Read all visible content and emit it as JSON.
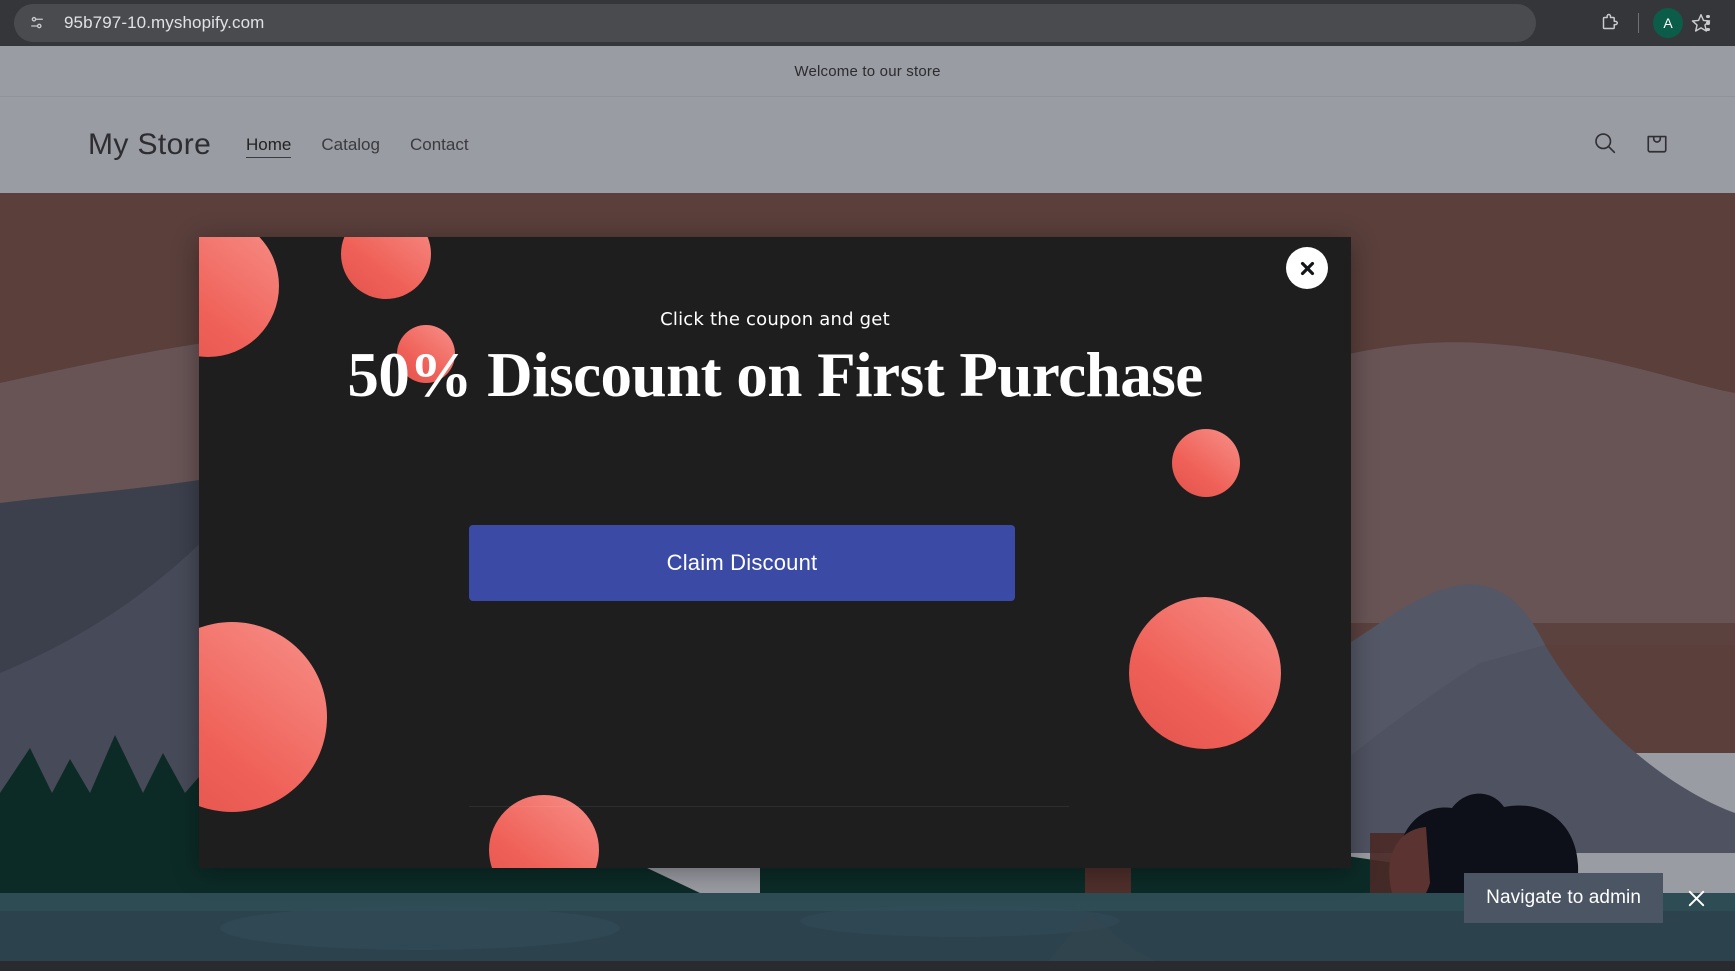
{
  "browser": {
    "url": "95b797-10.myshopify.com",
    "site_info_icon": "tune-icon",
    "bookmark_icon": "star-icon",
    "extensions_icon": "puzzle-piece-icon",
    "profile_initial": "A",
    "menu_icon": "three-dot-menu-icon"
  },
  "store": {
    "announcement": "Welcome to our store",
    "logo": "My Store",
    "nav": [
      {
        "label": "Home",
        "active": true
      },
      {
        "label": "Catalog",
        "active": false
      },
      {
        "label": "Contact",
        "active": false
      }
    ],
    "search_icon": "search-icon",
    "cart_icon": "shopping-bag-icon"
  },
  "modal": {
    "kicker": "Click the coupon and get",
    "title": "50% Discount on First Purchase",
    "cta_label": "Claim Discount",
    "close_icon": "close-x-icon",
    "accent_color": "#ef6158",
    "cta_color": "#3b4ba5",
    "background_color": "#1e1e1e"
  },
  "toast": {
    "button_label": "Navigate to admin",
    "close_icon": "close-x-icon"
  },
  "hero": {
    "alt": "flat illustration of mountains, pine forest, bear and lake at dusk",
    "sky_color": "#5a3f3b",
    "mountain_color": "#474a58",
    "forest_color": "#0c2b27",
    "lake_color": "#2b4750"
  }
}
